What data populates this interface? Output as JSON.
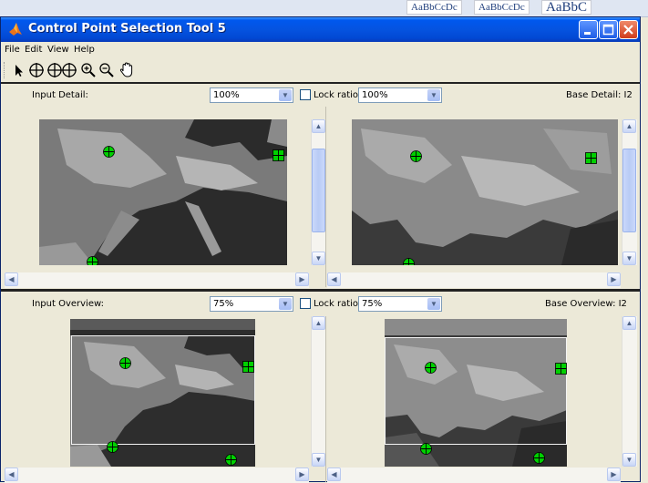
{
  "background_strip": {
    "swatches": [
      "AaBbCcDc",
      "AaBbCcDc",
      "AaBbC"
    ]
  },
  "window": {
    "title": "Control Point Selection Tool 5",
    "icon": "matlab-icon",
    "title_buttons": [
      "minimize-icon",
      "maximize-icon",
      "close-icon"
    ]
  },
  "menu": [
    "File",
    "Edit",
    "View",
    "Help"
  ],
  "toolbar": {
    "tools": [
      "select-arrow-icon",
      "add-point-icon",
      "predict-point-icon",
      "zoom-in-icon",
      "zoom-out-icon",
      "pan-hand-icon"
    ]
  },
  "detail_panel": {
    "input_label": "Input Detail:",
    "input_zoom": "100%",
    "lock_label": "Lock ratio",
    "base_zoom": "100%",
    "base_label": "Base Detail: I2"
  },
  "overview_panel": {
    "input_label": "Input Overview:",
    "input_zoom": "75%",
    "lock_label": "Lock ratio",
    "base_zoom": "75%",
    "base_label": "Base Overview: I2"
  },
  "colors": {
    "titlebar": "#0553e0",
    "window_bg": "#ece9d8",
    "control_point": "#00d000",
    "divider": "#222222"
  }
}
